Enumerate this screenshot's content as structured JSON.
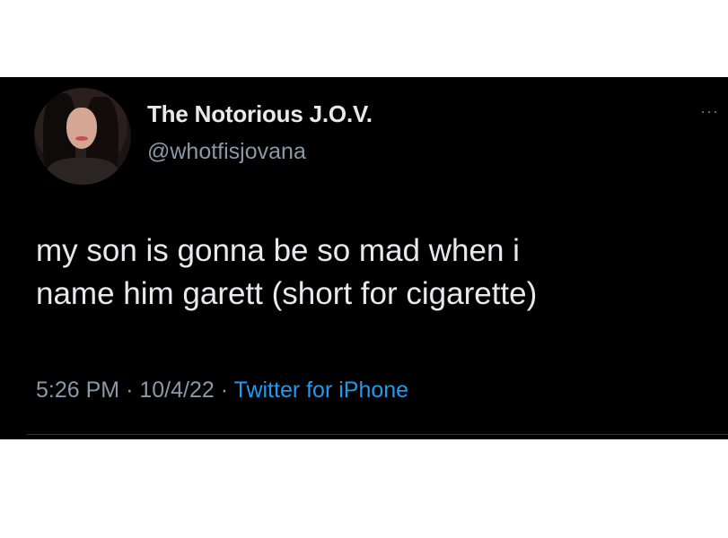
{
  "tweet": {
    "display_name": "The Notorious J.O.V.",
    "handle": "@whotfisjovana",
    "more_icon": "···",
    "text_lines": [
      "my son is gonna be so mad when i",
      "name him garett (short for cigarette)"
    ],
    "time": "5:26 PM",
    "separator": "·",
    "date": "10/4/22",
    "source": "Twitter for iPhone"
  },
  "colors": {
    "background": "#000000",
    "text": "#e7e9ea",
    "secondary": "#8b98a5",
    "link": "#1d9bf0"
  }
}
